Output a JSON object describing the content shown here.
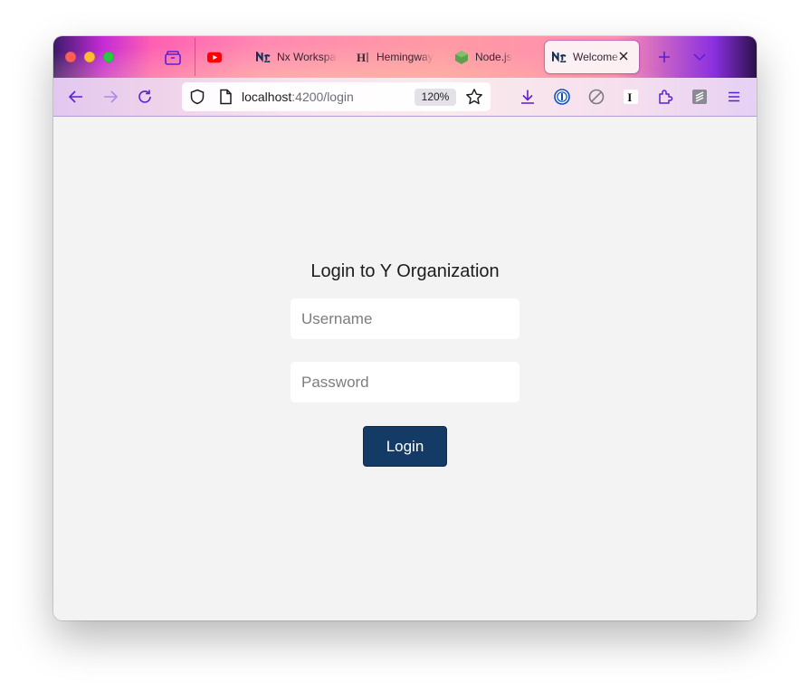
{
  "browser": {
    "tabs": [
      {
        "label": "",
        "favicon": "youtube-icon",
        "active": false
      },
      {
        "label": "Nx Workspace",
        "favicon": "nx-logo-icon",
        "active": false
      },
      {
        "label": "Hemingway",
        "favicon": "hemingway-icon",
        "active": false
      },
      {
        "label": "Node.js",
        "favicon": "nodejs-icon",
        "active": false
      },
      {
        "label": "Welcome",
        "favicon": "nx-logo-icon",
        "active": true
      }
    ],
    "url": {
      "host": "localhost",
      "path": ":4200/login"
    },
    "zoom": "120%",
    "toolbar_icons": [
      "download-icon",
      "onepassword-icon",
      "block-icon",
      "instapaper-icon",
      "extensions-icon",
      "notes-icon",
      "menu-icon"
    ],
    "accent_color": "#5b1fd1"
  },
  "login": {
    "title": "Login to Y Organization",
    "username_placeholder": "Username",
    "password_placeholder": "Password",
    "submit_label": "Login",
    "button_color": "#143a66"
  }
}
